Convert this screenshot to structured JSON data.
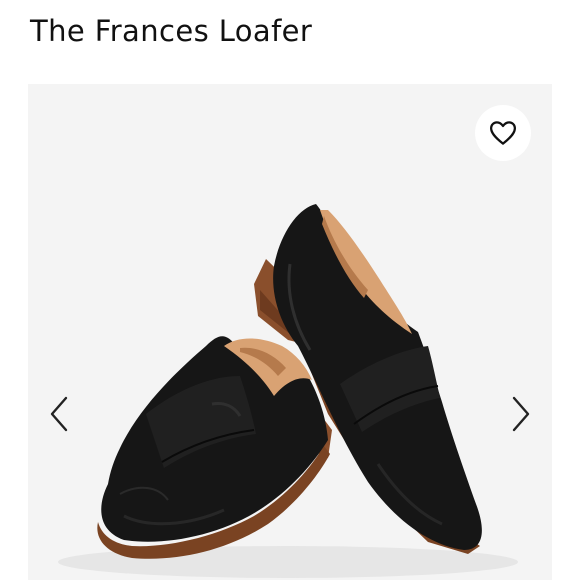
{
  "product": {
    "title": "The Frances Loafer"
  },
  "gallery": {
    "image_alt": "Black leather loafers",
    "favorite_icon": "heart-outline-icon",
    "prev_icon": "chevron-left-icon",
    "next_icon": "chevron-right-icon"
  },
  "colors": {
    "gallery_background": "#f4f4f4",
    "shoe_leather": "#161616",
    "shoe_sole": "#8a4f2c",
    "shoe_lining": "#d9a273"
  }
}
